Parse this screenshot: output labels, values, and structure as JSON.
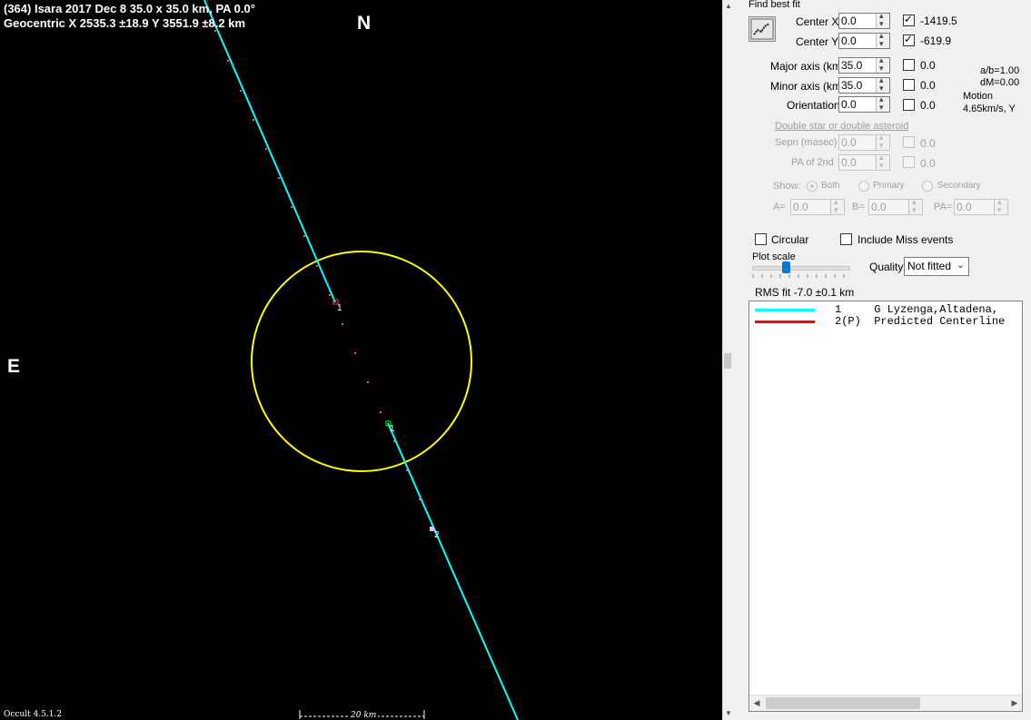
{
  "plot": {
    "title_line1": "(364) Isara  2017 Dec 8  35.0 x 35.0 km, PA 0.0°",
    "title_line2": "Geocentric  X  2535.3 ±18.9  Y 3551.9 ±8.2 km",
    "north_label": "N",
    "east_label": "E",
    "version": "Occult 4.5.1.2",
    "scale_label": "20 km",
    "chord_labels": [
      "1",
      "1",
      "2"
    ],
    "colors": {
      "background": "#000000",
      "ellipse": "#ffff00",
      "chord": "#00ffff",
      "dots": "#ff4040",
      "text": "#ffffff"
    }
  },
  "panel": {
    "find_best_fit_label": "Find best fit",
    "center_x": {
      "label": "Center X",
      "value": "0.0",
      "checked": true,
      "result": "-1419.5"
    },
    "center_y": {
      "label": "Center Y",
      "value": "0.0",
      "checked": true,
      "result": "-619.9"
    },
    "major_axis": {
      "label": "Major axis (km)",
      "value": "35.0",
      "checked": false,
      "result": "0.0"
    },
    "minor_axis": {
      "label": "Minor axis (km)",
      "value": "35.0",
      "checked": false,
      "result": "0.0"
    },
    "orientation": {
      "label": "Orientation",
      "value": "0.0",
      "checked": false,
      "result": "0.0"
    },
    "ab_ratio": "a/b=1.00",
    "dm": "dM=0.00",
    "motion_label": "Motion",
    "motion_value": "4.65km/s, Y",
    "double_star_link": "Double star  or  double asteroid",
    "sepn": {
      "label": "Sepn (masec)",
      "value": "0.0",
      "result": "0.0"
    },
    "pa2nd": {
      "label": "PA of 2nd",
      "value": "0.0",
      "result": "0.0"
    },
    "show_label": "Show:",
    "show_options": [
      "Both",
      "Primary",
      "Secondary"
    ],
    "a_label": "A=",
    "a_value": "0.0",
    "b_label": "B=",
    "b_value": "0.0",
    "pa_label": "PA=",
    "pa_value": "0.0",
    "circular_label": "Circular",
    "include_miss_label": "Include Miss events",
    "plot_scale_label": "Plot scale",
    "quality_label": "Quality",
    "quality_value": "Not fitted",
    "rms_fit": "RMS fit  -7.0 ±0.1 km",
    "observers": [
      {
        "color": "#00ffff",
        "text": "1     G Lyzenga,Altadena,"
      },
      {
        "color": "#ff0000",
        "text": "2(P)  Predicted Centerline"
      }
    ]
  }
}
